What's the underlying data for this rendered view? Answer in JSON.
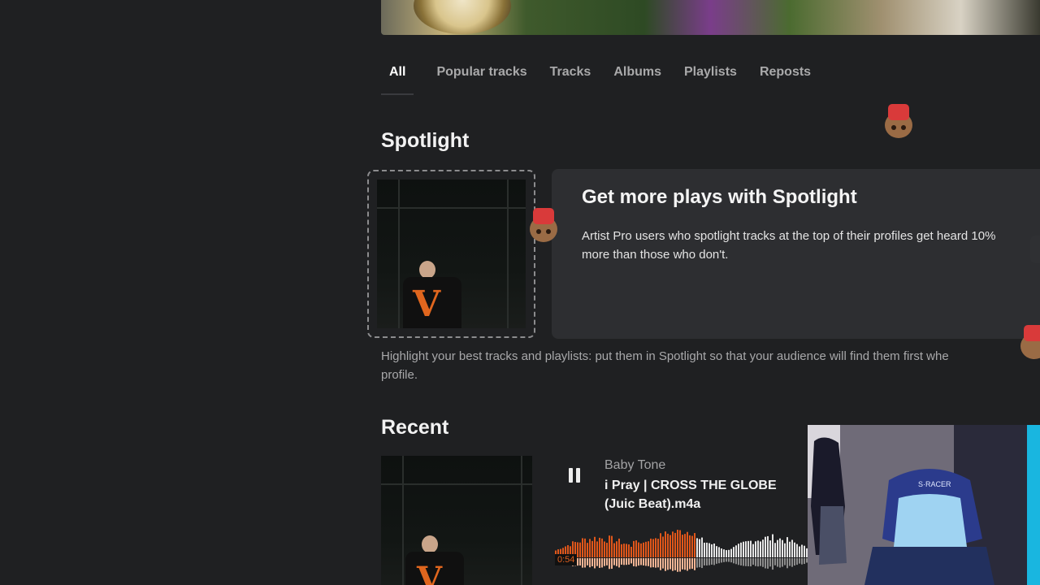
{
  "tabs": [
    {
      "label": "All",
      "active": true
    },
    {
      "label": "Popular tracks",
      "active": false
    },
    {
      "label": "Tracks",
      "active": false
    },
    {
      "label": "Albums",
      "active": false
    },
    {
      "label": "Playlists",
      "active": false
    },
    {
      "label": "Reposts",
      "active": false
    }
  ],
  "spotlight": {
    "section_title": "Spotlight",
    "card_title": "Get more plays with Spotlight",
    "card_text": "Artist Pro users who spotlight tracks at the top of their profiles get heard 10% more than those who don't.",
    "hint_line1": "Highlight your best tracks and playlists: put them in Spotlight so that your audience will find them first whe",
    "hint_line2": "profile."
  },
  "recent": {
    "section_title": "Recent",
    "track": {
      "artist": "Baby Tone",
      "title": "i Pray | CROSS THE GLOBE (Juic Beat).m4a",
      "time": "0:54",
      "played_fraction": 0.55,
      "state": "playing"
    }
  },
  "colors": {
    "background": "#1f2022",
    "card": "#2d2e31",
    "played": "#e0561a",
    "unplayed": "#e6e6e6"
  },
  "icons": {
    "pause": "pause-icon",
    "mascot": "mascot-sticker-icon"
  }
}
